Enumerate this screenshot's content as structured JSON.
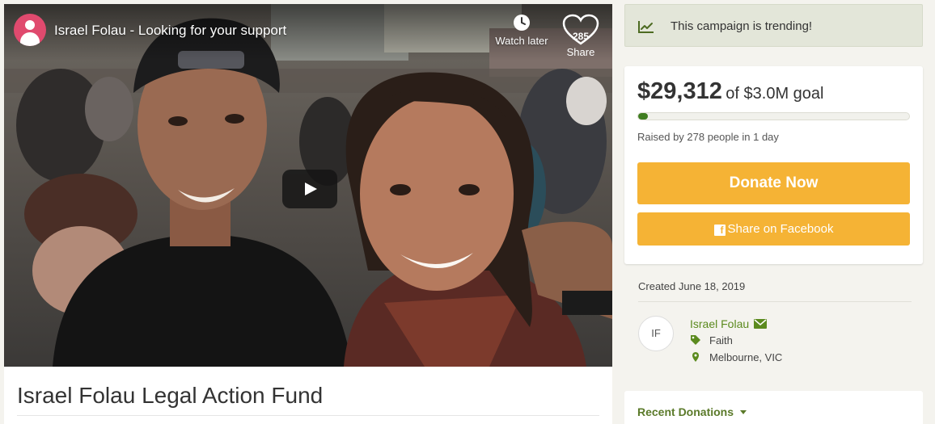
{
  "video": {
    "title": "Israel Folau - Looking for your support",
    "watch_later_label": "Watch later",
    "share_count": "285",
    "share_label": "Share"
  },
  "campaign": {
    "title": "Israel Folau Legal Action Fund"
  },
  "trending": {
    "text": "This campaign is trending!"
  },
  "donation": {
    "amount_raised": "$29,312",
    "goal_text": "of $3.0M goal",
    "progress_fraction": 0.0098,
    "raised_by_text": "Raised by 278 people in 1 day",
    "donate_label": "Donate Now",
    "share_label": "Share on Facebook"
  },
  "details": {
    "created_text": "Created June 18, 2019",
    "organizer_initials": "IF",
    "organizer_name": "Israel Folau",
    "category": "Faith",
    "location": "Melbourne, VIC"
  },
  "recent": {
    "label": "Recent Donations"
  },
  "colors": {
    "accent_button": "#f5b335",
    "link_green": "#5b8a1e",
    "progress_green": "#3f7d20",
    "trend_bg": "#e3e6d9"
  }
}
